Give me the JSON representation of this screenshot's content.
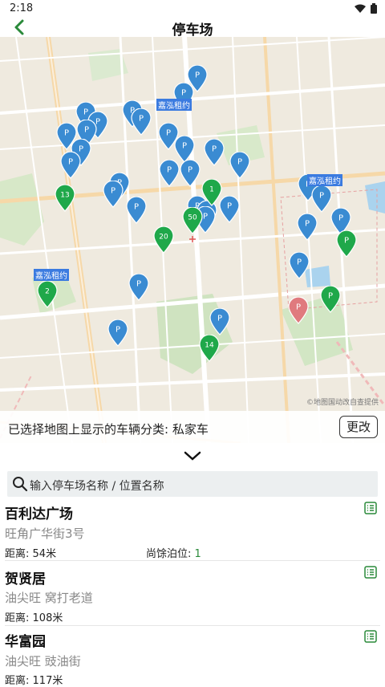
{
  "status": {
    "time": "2:18"
  },
  "header": {
    "title": "停车场"
  },
  "map": {
    "brand_labels": [
      "嘉泓租约",
      "嘉泓租约",
      "嘉泓租约"
    ],
    "markers": [
      {
        "label": "P",
        "color": "#3a8bd2"
      },
      {
        "label": "P",
        "color": "#3a8bd2"
      },
      {
        "label": "P",
        "color": "#3a8bd2"
      },
      {
        "label": "P",
        "color": "#3a8bd2"
      },
      {
        "label": "P",
        "color": "#3a8bd2"
      },
      {
        "label": "P",
        "color": "#3a8bd2"
      },
      {
        "label": "P",
        "color": "#3a8bd2"
      },
      {
        "label": "P",
        "color": "#3a8bd2"
      },
      {
        "label": "P",
        "color": "#3a8bd2"
      },
      {
        "label": "P",
        "color": "#3a8bd2"
      },
      {
        "label": "P",
        "color": "#3a8bd2"
      },
      {
        "label": "P",
        "color": "#3a8bd2"
      },
      {
        "label": "P",
        "color": "#3a8bd2"
      },
      {
        "label": "P",
        "color": "#3a8bd2"
      },
      {
        "label": "P",
        "color": "#3a8bd2"
      },
      {
        "label": "P",
        "color": "#3a8bd2"
      },
      {
        "label": "P",
        "color": "#3a8bd2"
      },
      {
        "label": "P",
        "color": "#3a8bd2"
      },
      {
        "label": "P",
        "color": "#3a8bd2"
      },
      {
        "label": "P",
        "color": "#3a8bd2"
      },
      {
        "label": "P",
        "color": "#3a8bd2"
      },
      {
        "label": "P",
        "color": "#3a8bd2"
      },
      {
        "label": "P",
        "color": "#3a8bd2"
      },
      {
        "label": "P",
        "color": "#3a8bd2"
      },
      {
        "label": "P",
        "color": "#3a8bd2"
      },
      {
        "label": "P",
        "color": "#3a8bd2"
      },
      {
        "label": "P",
        "color": "#3a8bd2"
      },
      {
        "label": "P",
        "color": "#3a8bd2"
      },
      {
        "label": "P",
        "color": "#3a8bd2"
      },
      {
        "label": "P",
        "color": "#3a8bd2"
      },
      {
        "label": "P",
        "color": "#3a8bd2"
      },
      {
        "label": "14",
        "color": "#1fa84a"
      },
      {
        "label": "13",
        "color": "#1fa84a"
      },
      {
        "label": "1",
        "color": "#1fa84a"
      },
      {
        "label": "50",
        "color": "#1fa84a"
      },
      {
        "label": "20",
        "color": "#1fa84a"
      },
      {
        "label": "2",
        "color": "#1fa84a"
      },
      {
        "label": "P",
        "color": "#1fa84a"
      },
      {
        "label": "P",
        "color": "#1fa84a"
      },
      {
        "label": "P",
        "color": "#e07a7e"
      }
    ],
    "copyright": "©地图国动改自查提供"
  },
  "filter": {
    "text": "已选择地图上显示的车辆分类: 私家车",
    "change_button": "更改"
  },
  "search": {
    "placeholder": "输入停车场名称 / 位置名称"
  },
  "list": [
    {
      "name": "百利达广场",
      "address": "旺角广华街3号",
      "distance_label": "距离:",
      "distance": "54米",
      "spaces_label": "尚馀泊位:",
      "spaces": "1"
    },
    {
      "name": "贺贤居",
      "address": "油尖旺 窝打老道",
      "distance_label": "距离:",
      "distance": "108米"
    },
    {
      "name": "华富园",
      "address": "油尖旺 豉油街",
      "distance_label": "距离:",
      "distance": "117米"
    }
  ],
  "colors": {
    "pin_blue": "#3a8bd2",
    "pin_green": "#1fa84a",
    "pin_red": "#e07a7e",
    "accent_green": "#2a8a3a"
  }
}
